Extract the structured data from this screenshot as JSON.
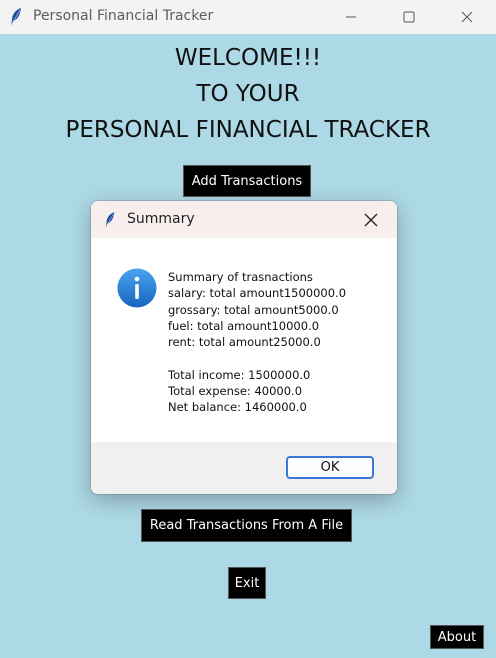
{
  "window": {
    "title": "Personal Financial Tracker",
    "background_color": "#add8e6"
  },
  "main": {
    "welcome_lines": [
      "WELCOME!!!",
      "TO YOUR",
      "PERSONAL FINANCIAL TRACKER"
    ],
    "add_button": "Add Transactions",
    "read_button": "Read Transactions From A File",
    "exit_button": "Exit",
    "about_button": "About"
  },
  "dialog": {
    "title": "Summary",
    "icon": "info-icon",
    "lines": [
      "Summary of trasnactions",
      "salary: total amount1500000.0",
      "grossary: total amount5000.0",
      "fuel: total amount10000.0",
      "rent: total amount25000.0"
    ],
    "totals": {
      "income": "Total income: 1500000.0",
      "expense": "Total expense: 40000.0",
      "net": "Net balance: 1460000.0"
    },
    "ok_button": "OK",
    "accent_color": "#3c78d8"
  }
}
